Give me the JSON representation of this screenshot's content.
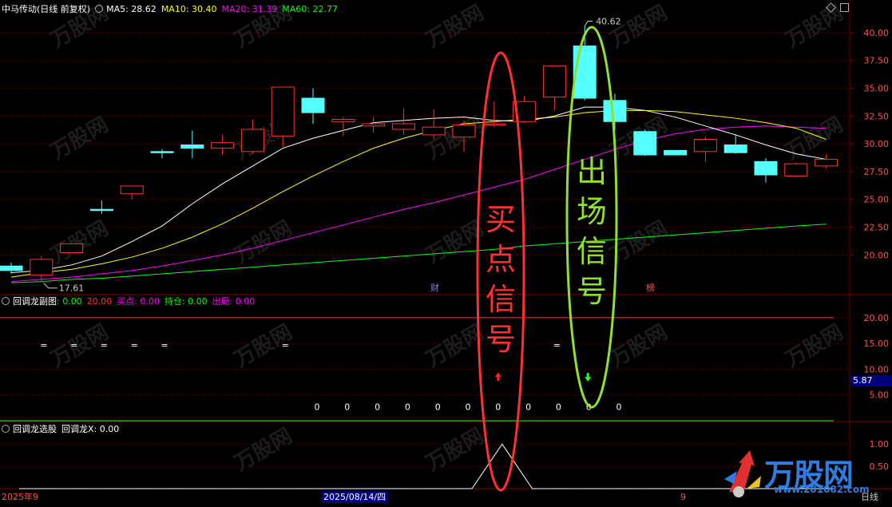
{
  "main_panel": {
    "stock_name": "中马传动(日线 前复权)",
    "ma_labels": [
      {
        "label": "MA5: 28.62",
        "color": "#ffffff"
      },
      {
        "label": "MA10: 30.40",
        "color": "#ffff00"
      },
      {
        "label": "MA20: 31.39",
        "color": "#ff00ff"
      },
      {
        "label": "MA60: 22.77",
        "color": "#00ff00"
      }
    ],
    "high_marker": "40.62",
    "low_marker": "17.61",
    "event_badge_1": "财",
    "event_badge_2": "榜",
    "annotation_buy": "买点信号",
    "annotation_sell": "出场信号"
  },
  "sub_panel_1": {
    "name": "回调龙副图",
    "items": [
      {
        "label": ": 0.00",
        "color": "#00ff00"
      },
      {
        "label": "20.00",
        "color": "#ff3030"
      },
      {
        "label": "买点: 0.00",
        "color": "#ff00ff"
      },
      {
        "label": "持仓: 0.00",
        "color": "#00ff00"
      },
      {
        "label": "出局: 0.00",
        "color": "#ff00ff"
      }
    ],
    "current_value": "5.87",
    "eq_marker": "=",
    "zero_marker": "0"
  },
  "sub_panel_2": {
    "name": "回调龙选股",
    "value_label": "回调龙X: 0.00"
  },
  "bottom_bar": {
    "left_date": "2025年9",
    "cursor_date": "2025/08/14/四",
    "mid_label": "9",
    "period": "日线"
  },
  "brand": {
    "logo_text": "万股网",
    "url": "www.201082.com"
  },
  "watermark_text": "万股网",
  "colors": {
    "up": "#ff3232",
    "down": "#54ffff",
    "grid": "#7a0000",
    "ma5": "#ffffff",
    "ma10": "#ffff00",
    "ma20": "#ff00ff",
    "ma60": "#00ff00"
  },
  "chart_data": [
    {
      "type": "candlestick",
      "title": "中马传动(日线 前复权)",
      "y_ticks": [
        "40.00",
        "37.50",
        "35.00",
        "32.50",
        "30.00",
        "27.50",
        "25.00",
        "22.50",
        "20.00"
      ],
      "ylim": [
        16.5,
        41.5
      ],
      "candles": [
        {
          "o": 19.0,
          "c": 18.6,
          "h": 19.3,
          "l": 18.3
        },
        {
          "o": 18.2,
          "c": 19.6,
          "h": 19.9,
          "l": 17.6
        },
        {
          "o": 20.2,
          "c": 21.0,
          "h": 21.0,
          "l": 20.2
        },
        {
          "o": 24.1,
          "c": 24.0,
          "h": 24.9,
          "l": 23.7
        },
        {
          "o": 25.5,
          "c": 26.2,
          "h": 26.2,
          "l": 25.0
        },
        {
          "o": 29.3,
          "c": 29.2,
          "h": 29.5,
          "l": 28.7
        },
        {
          "o": 29.9,
          "c": 29.6,
          "h": 31.2,
          "l": 28.7
        },
        {
          "o": 29.6,
          "c": 30.1,
          "h": 30.8,
          "l": 29.0
        },
        {
          "o": 29.3,
          "c": 31.3,
          "h": 32.2,
          "l": 29.1
        },
        {
          "o": 30.7,
          "c": 35.1,
          "h": 35.1,
          "l": 29.7
        },
        {
          "o": 34.1,
          "c": 32.8,
          "h": 35.0,
          "l": 31.8
        },
        {
          "o": 32.0,
          "c": 32.2,
          "h": 32.4,
          "l": 30.7
        },
        {
          "o": 31.6,
          "c": 31.8,
          "h": 32.4,
          "l": 31.0
        },
        {
          "o": 31.3,
          "c": 31.8,
          "h": 33.2,
          "l": 30.8
        },
        {
          "o": 30.8,
          "c": 31.5,
          "h": 33.1,
          "l": 30.4
        },
        {
          "o": 30.6,
          "c": 31.7,
          "h": 32.1,
          "l": 29.3
        },
        {
          "o": 31.8,
          "c": 31.8,
          "h": 33.8,
          "l": 31.5
        },
        {
          "o": 32.0,
          "c": 33.8,
          "h": 34.3,
          "l": 31.9
        },
        {
          "o": 34.2,
          "c": 37.0,
          "h": 37.0,
          "l": 33.0
        },
        {
          "o": 38.8,
          "c": 34.1,
          "h": 40.6,
          "l": 33.9
        },
        {
          "o": 33.9,
          "c": 32.0,
          "h": 34.5,
          "l": 31.2
        },
        {
          "o": 31.1,
          "c": 29.0,
          "h": 31.3,
          "l": 28.9
        },
        {
          "o": 29.4,
          "c": 29.0,
          "h": 29.4,
          "l": 29.0
        },
        {
          "o": 29.3,
          "c": 30.4,
          "h": 30.6,
          "l": 28.4
        },
        {
          "o": 29.9,
          "c": 29.2,
          "h": 30.9,
          "l": 29.1
        },
        {
          "o": 28.4,
          "c": 27.2,
          "h": 28.7,
          "l": 26.5
        },
        {
          "o": 27.1,
          "c": 28.2,
          "h": 28.3,
          "l": 27.0
        },
        {
          "o": 28.0,
          "c": 28.6,
          "h": 29.0,
          "l": 27.8
        }
      ],
      "ma5": [
        18.4,
        18.6,
        19.1,
        19.9,
        21.2,
        22.6,
        24.6,
        26.4,
        28.0,
        29.6,
        30.5,
        31.2,
        31.9,
        32.1,
        32.3,
        32.4,
        32.1,
        32.0,
        32.5,
        33.3,
        33.3,
        33.0,
        32.4,
        31.6,
        30.8,
        29.9,
        29.1,
        28.6
      ],
      "ma10": [
        18.0,
        18.4,
        18.7,
        19.2,
        19.8,
        20.6,
        21.6,
        22.8,
        24.2,
        25.7,
        27.1,
        28.4,
        29.6,
        30.5,
        31.2,
        31.8,
        32.0,
        32.2,
        32.4,
        32.8,
        33.0,
        33.0,
        32.9,
        32.6,
        32.3,
        31.9,
        31.4,
        30.4
      ],
      "ma20": [
        17.6,
        17.8,
        18.0,
        18.3,
        18.6,
        19.0,
        19.5,
        20.0,
        20.6,
        21.3,
        22.0,
        22.7,
        23.4,
        24.1,
        24.7,
        25.4,
        26.1,
        26.8,
        27.7,
        28.6,
        29.5,
        30.3,
        30.9,
        31.3,
        31.5,
        31.6,
        31.5,
        31.39
      ],
      "ma60": [
        17.5,
        17.6,
        17.8,
        17.9,
        18.1,
        18.3,
        18.5,
        18.7,
        18.9,
        19.1,
        19.3,
        19.5,
        19.7,
        19.9,
        20.1,
        20.3,
        20.5,
        20.8,
        21.0,
        21.2,
        21.4,
        21.6,
        21.8,
        22.0,
        22.2,
        22.4,
        22.6,
        22.77
      ]
    },
    {
      "type": "indicator",
      "title": "回调龙副图",
      "y_ticks": [
        "20.00",
        "15.00",
        "10.00",
        "5.00"
      ],
      "ylim": [
        0,
        22
      ],
      "upper_line": 20,
      "lower_line": 0,
      "eq_marks_at": [
        1,
        2,
        3,
        4,
        5,
        9,
        18
      ],
      "zero_marks_at": [
        10,
        11,
        12,
        13,
        14,
        15,
        16,
        17,
        18,
        19,
        20
      ],
      "buy_arrow_at": 16,
      "sell_arrow_at": 19
    },
    {
      "type": "line",
      "title": "回调龙选股",
      "y_ticks": [
        "1.00",
        "0.50"
      ],
      "ylim": [
        0,
        1.2
      ],
      "values": [
        0,
        0,
        0,
        0,
        0,
        0,
        0,
        0,
        0,
        0,
        0,
        0,
        0,
        0,
        0,
        0,
        1,
        0,
        0,
        0,
        0,
        0,
        0,
        0,
        0,
        0,
        0,
        0
      ]
    }
  ]
}
